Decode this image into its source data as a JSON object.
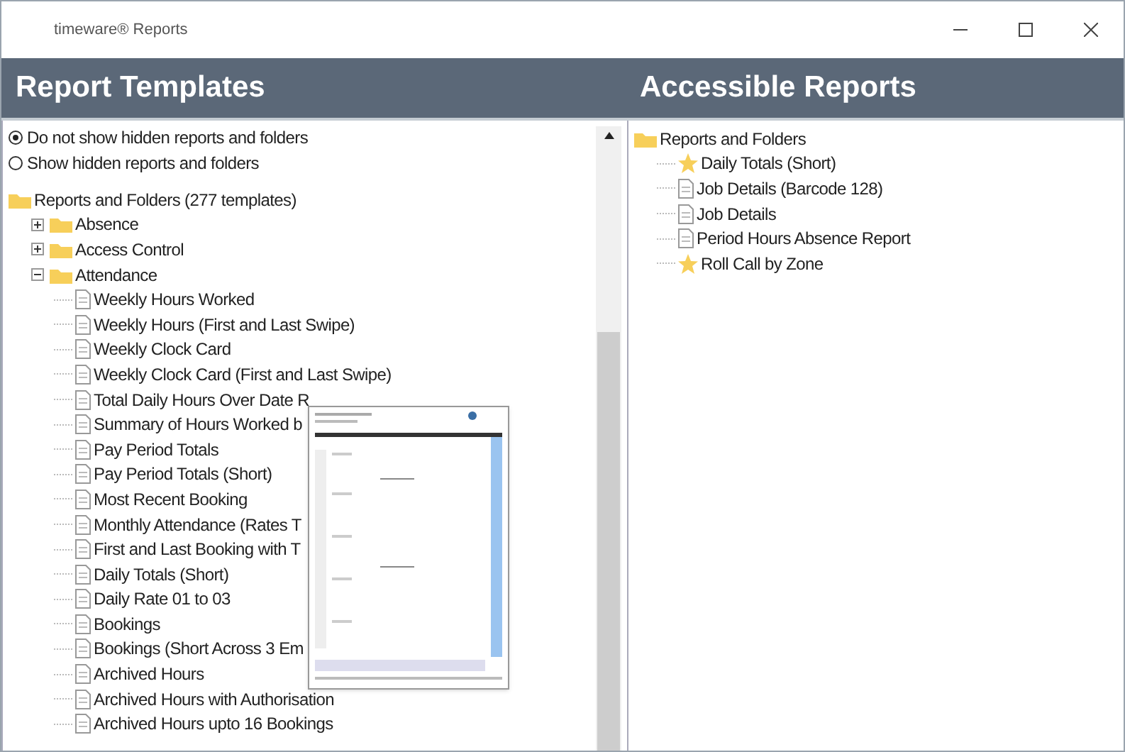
{
  "window": {
    "title": "timeware® Reports"
  },
  "left_panel": {
    "title": "Report Templates",
    "options": [
      {
        "label": "Do not show hidden reports and folders",
        "selected": true
      },
      {
        "label": "Show hidden reports and folders",
        "selected": false
      }
    ],
    "tree": {
      "label": "Reports and Folders (277 templates)",
      "kind": "folder",
      "children": [
        {
          "label": "Absence",
          "kind": "folder",
          "expanded": false
        },
        {
          "label": "Access Control",
          "kind": "folder",
          "expanded": false
        },
        {
          "label": "Attendance",
          "kind": "folder",
          "expanded": true,
          "children": [
            {
              "label": "Weekly Hours Worked",
              "kind": "report"
            },
            {
              "label": "Weekly Hours (First and Last Swipe)",
              "kind": "report"
            },
            {
              "label": "Weekly Clock Card",
              "kind": "report"
            },
            {
              "label": "Weekly Clock Card (First and Last Swipe)",
              "kind": "report"
            },
            {
              "label": "Total Daily Hours Over Date R",
              "kind": "report"
            },
            {
              "label": "Summary of Hours Worked b",
              "kind": "report"
            },
            {
              "label": "Pay Period Totals",
              "kind": "report"
            },
            {
              "label": "Pay Period Totals (Short)",
              "kind": "report"
            },
            {
              "label": "Most Recent Booking",
              "kind": "report"
            },
            {
              "label": "Monthly Attendance (Rates T",
              "kind": "report"
            },
            {
              "label": "First and Last Booking with T",
              "kind": "report"
            },
            {
              "label": "Daily Totals (Short)",
              "kind": "report"
            },
            {
              "label": "Daily Rate 01 to 03",
              "kind": "report"
            },
            {
              "label": "Bookings",
              "kind": "report"
            },
            {
              "label": "Bookings (Short Across 3 Em",
              "kind": "report"
            },
            {
              "label": "Archived Hours",
              "kind": "report"
            },
            {
              "label": "Archived Hours with Authorisation",
              "kind": "report"
            },
            {
              "label": "Archived Hours upto 16 Bookings",
              "kind": "report"
            }
          ]
        }
      ]
    }
  },
  "right_panel": {
    "title": "Accessible Reports",
    "tree": {
      "label": "Reports and Folders",
      "kind": "folder",
      "children": [
        {
          "label": "Daily Totals (Short)",
          "kind": "favourite"
        },
        {
          "label": "Job Details (Barcode 128)",
          "kind": "report"
        },
        {
          "label": "Job Details",
          "kind": "report"
        },
        {
          "label": "Period Hours Absence Report",
          "kind": "report"
        },
        {
          "label": "Roll Call by Zone",
          "kind": "favourite"
        }
      ]
    }
  }
}
